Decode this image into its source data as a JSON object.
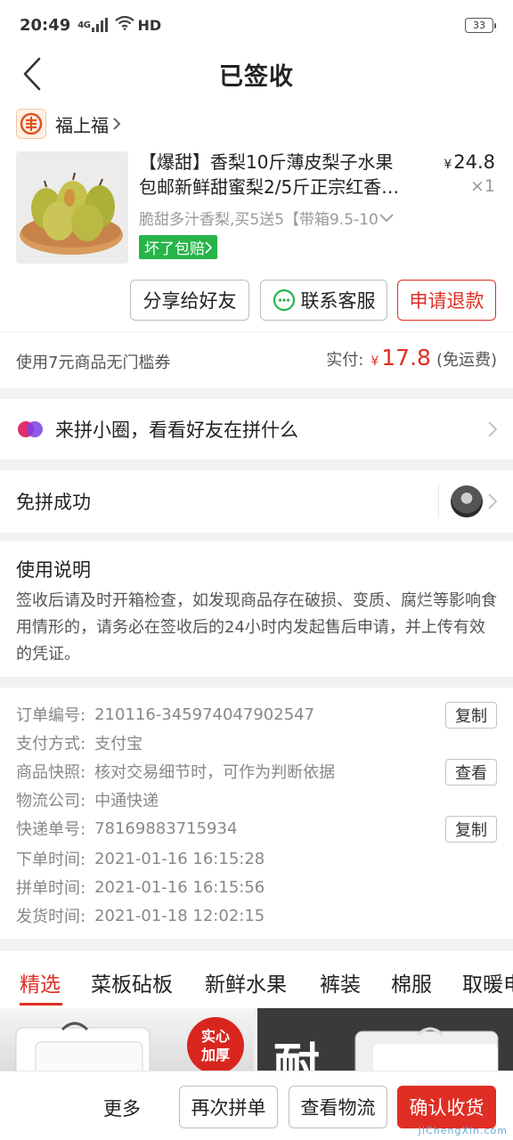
{
  "status_bar": {
    "time": "20:49",
    "network": "4G",
    "hd": "HD",
    "battery": "33"
  },
  "nav": {
    "title": "已签收"
  },
  "store": {
    "name": "福上福"
  },
  "product": {
    "title_line1": "【爆甜】香梨10斤薄皮梨子水果",
    "title_line2": "包邮新鲜甜蜜梨2/5斤正宗红香…",
    "price_symbol": "¥",
    "price": "24.8",
    "quantity": "×1",
    "spec": "脆甜多汁香梨,买5送5【带箱9.5-10",
    "guarantee": "坏了包赔"
  },
  "actions": {
    "share": "分享给好友",
    "contact": "联系客服",
    "refund": "申请退款"
  },
  "payment": {
    "coupon": "使用7元商品无门槛券",
    "paid_label": "实付:",
    "symbol": "¥",
    "amount": "17.8",
    "shipping": "(免运费)"
  },
  "circle": {
    "text": "来拼小圈，看看好友在拼什么"
  },
  "mianpin": {
    "text": "免拼成功"
  },
  "usage": {
    "title": "使用说明",
    "body": "签收后请及时开箱检查，如发现商品存在破损、变质、腐烂等影响食用情形的，请务必在签收后的24小时内发起售后申请，并上传有效的凭证。"
  },
  "order_info": {
    "rows": [
      {
        "label": "订单编号:",
        "value": "210116-345974047902547"
      },
      {
        "label": "支付方式:",
        "value": "支付宝"
      },
      {
        "label": "商品快照:",
        "value": "核对交易细节时，可作为判断依据"
      },
      {
        "label": "物流公司:",
        "value": "中通快递"
      },
      {
        "label": "快递单号:",
        "value": "78169883715934"
      },
      {
        "label": "下单时间:",
        "value": "2021-01-16 16:15:28"
      },
      {
        "label": "拼单时间:",
        "value": "2021-01-16 16:15:56"
      },
      {
        "label": "发货时间:",
        "value": "2021-01-18 12:02:15"
      }
    ],
    "copy_label": "复制",
    "view_label": "查看"
  },
  "tabs": [
    "精选",
    "菜板砧板",
    "新鲜水果",
    "裤装",
    "棉服",
    "取暖电"
  ],
  "banners": {
    "left_badge_1": "实心",
    "left_badge_2": "加厚",
    "right_char": "耐"
  },
  "bottom": {
    "more": "更多",
    "reorder": "再次拼单",
    "logistics": "查看物流",
    "confirm": "确认收货"
  },
  "watermark": "JiChengXin.com",
  "colors": {
    "accent": "#e02e24",
    "guarantee_green": "#27b44a",
    "wechat_green": "#27b44a"
  }
}
